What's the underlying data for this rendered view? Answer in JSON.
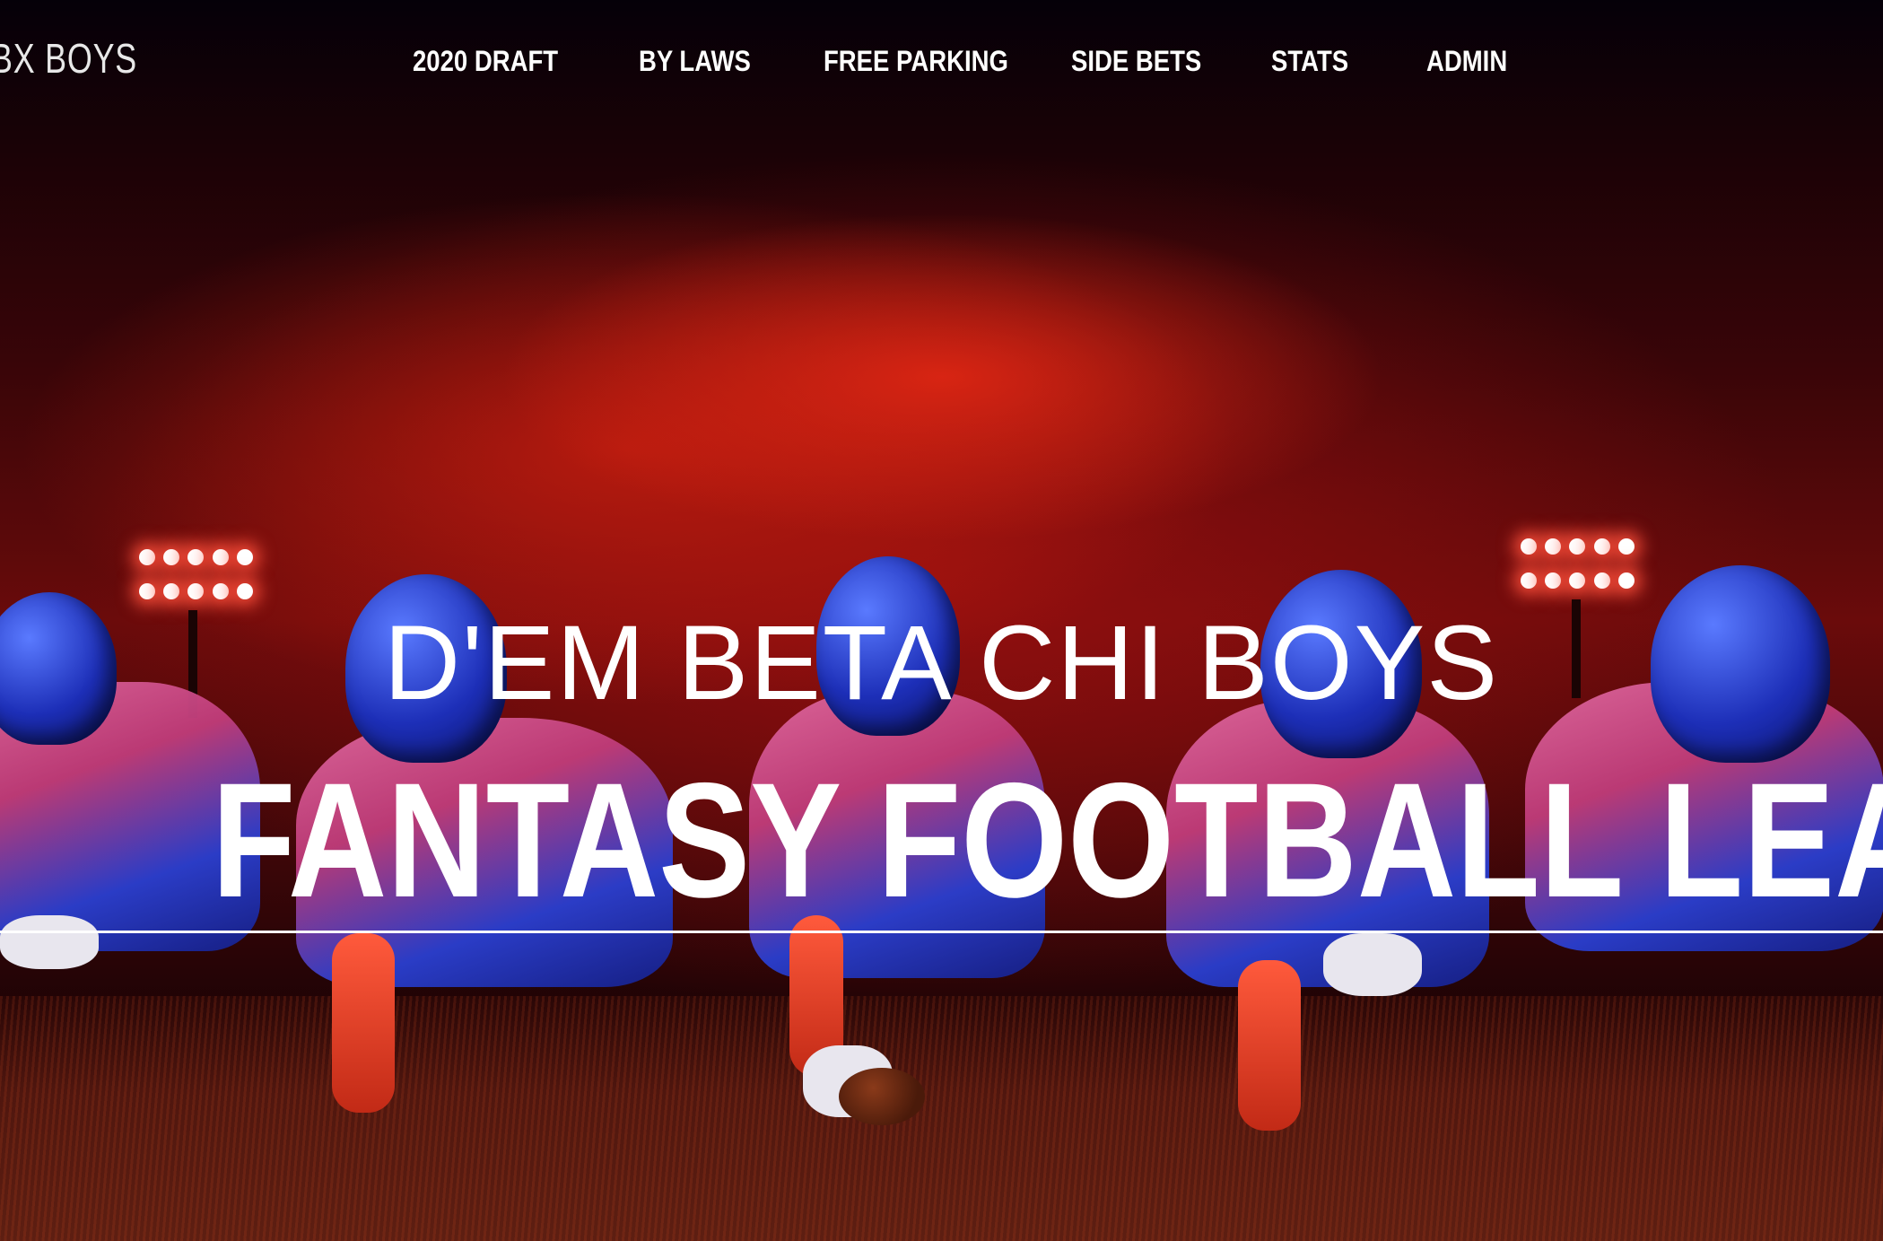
{
  "header": {
    "logo": "BX BOYS"
  },
  "nav": {
    "items": [
      {
        "label": "2020 DRAFT"
      },
      {
        "label": "BY LAWS"
      },
      {
        "label": "FREE PARKING"
      },
      {
        "label": "SIDE BETS"
      },
      {
        "label": "STATS"
      },
      {
        "label": "ADMIN"
      }
    ]
  },
  "hero": {
    "subtitle": "D'EM BETA CHI BOYS",
    "title": "FANTASY FOOTBALL LEAGUE"
  }
}
